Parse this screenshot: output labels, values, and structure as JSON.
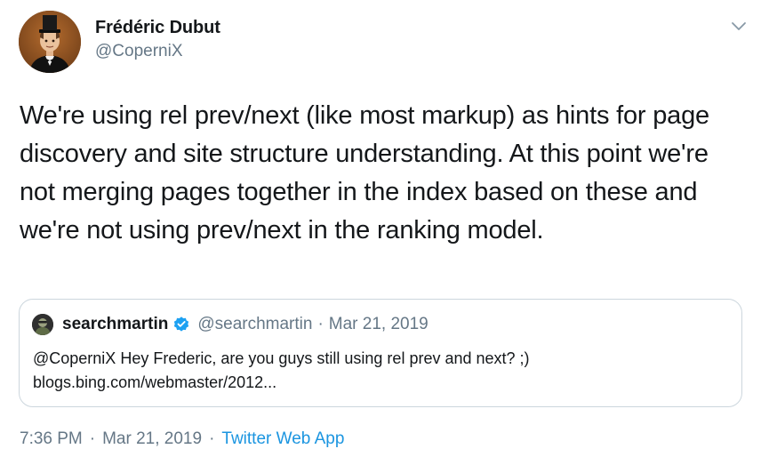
{
  "author": {
    "name": "Frédéric Dubut",
    "handle": "@CoperniX"
  },
  "tweet": {
    "text": "We're using rel prev/next (like most markup) as hints for page discovery and site structure understanding. At this point we're not merging pages together in the index based on these and we're not using prev/next in the ranking model."
  },
  "quoted_tweet": {
    "name": "searchmartin",
    "handle": "@searchmartin",
    "separator": "·",
    "date": "Mar 21, 2019",
    "text_line1": "@CoperniX Hey Frederic, are you guys still using rel prev and next? ;)",
    "text_line2": "blogs.bing.com/webmaster/2012..."
  },
  "meta": {
    "time": "7:36 PM",
    "separator": "·",
    "date": "Mar 21, 2019",
    "source": "Twitter Web App"
  },
  "icons": {
    "menu": "chevron-down-icon",
    "verified": "verified-badge-icon"
  },
  "colors": {
    "text": "#14171a",
    "secondary": "#657786",
    "link": "#1b95e0",
    "border": "#ccd6dd"
  }
}
